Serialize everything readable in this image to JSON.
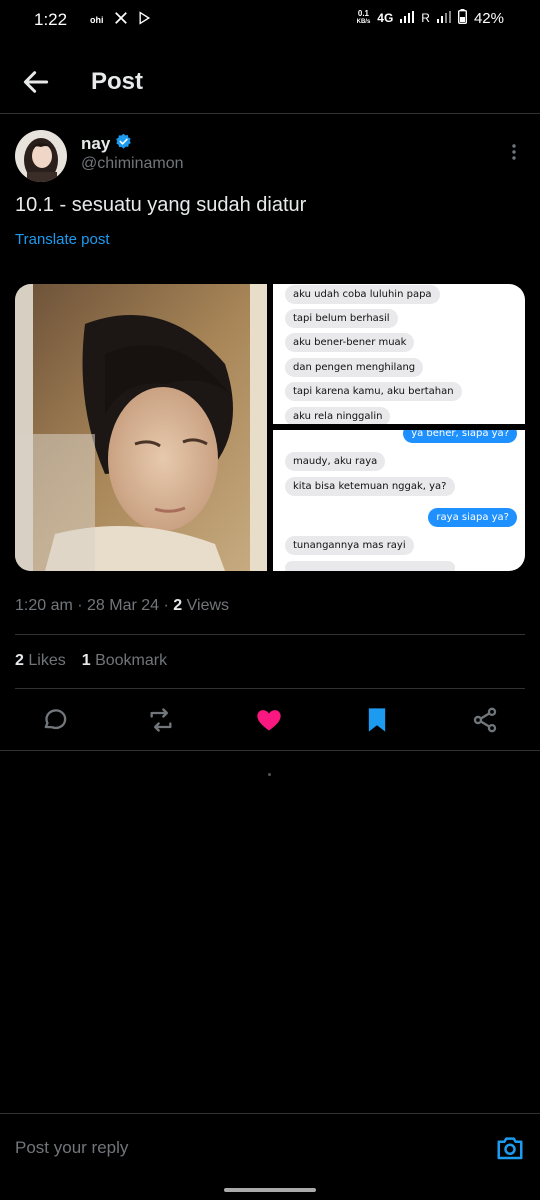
{
  "status_bar": {
    "time": "1:22",
    "left_icons": [
      "ohi",
      "x-logo-icon",
      "play-store-icon"
    ],
    "net_speed_value": "0.1",
    "net_speed_unit": "KB/s",
    "network": "4G",
    "roaming": "R",
    "battery": "42%"
  },
  "header": {
    "title": "Post",
    "back_icon": "arrow-left-icon"
  },
  "post": {
    "author": {
      "name": "nay",
      "handle": "@chiminamon",
      "verified": true
    },
    "text": "10.1 - sesuatu yang sudah diatur",
    "translate_label": "Translate post",
    "media": {
      "chat_top": [
        "aku udah coba luluhin papa",
        "tapi belum berhasil",
        "aku bener-bener muak",
        "dan pengen menghilang",
        "tapi karena kamu, aku bertahan",
        "aku rela ninggalin"
      ],
      "chat_bottom": {
        "out_1": "ya bener, siapa ya?",
        "in_1": "maudy, aku raya",
        "in_2": "kita bisa ketemuan nggak, ya?",
        "out_2": "raya siapa ya?",
        "in_3": "tunangannya mas rayi"
      }
    },
    "meta": {
      "time": "1:20 am",
      "date": "28 Mar 24",
      "views_count": "2",
      "views_label": "Views"
    },
    "stats": {
      "likes_count": "2",
      "likes_label": "Likes",
      "bookmarks_count": "1",
      "bookmarks_label": "Bookmark"
    },
    "actions": [
      "reply-icon",
      "repost-icon",
      "like-icon",
      "bookmark-icon",
      "share-icon"
    ]
  },
  "reply": {
    "placeholder": "Post your reply"
  },
  "colors": {
    "background": "#000000",
    "accent_blue": "#1d9bf0",
    "like_pink": "#f91880",
    "secondary_text": "#71767b",
    "divider": "#2f3336"
  }
}
